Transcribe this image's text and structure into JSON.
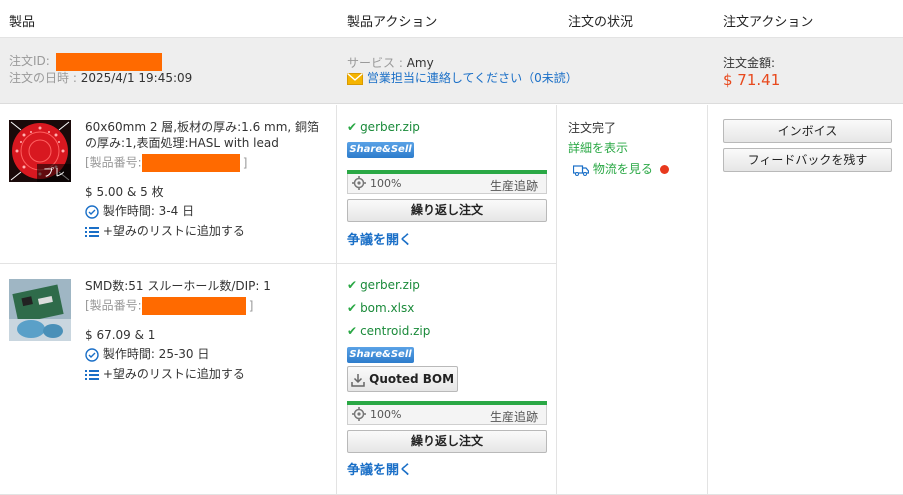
{
  "header": {
    "col_product": "製品",
    "col_product_action": "製品アクション",
    "col_order_status": "注文の状況",
    "col_order_action": "注文アクション"
  },
  "order": {
    "id_label": "注文ID:",
    "date_label": "注文の日時 :",
    "date_value": "2025/4/1 19:45:09",
    "service_label": "サービス :",
    "service_name": "Amy",
    "contact_text": "営業担当に連絡してください（0未読）",
    "amount_label": "注文金額:",
    "amount_value": "$ 71.41"
  },
  "items": [
    {
      "description": "60x60mm 2 層,板材の厚み:1.6 mm, 銅箔の厚み:1,表面処理:HASL with lead",
      "part_no_label": "[製品番号:",
      "part_no_close": "]",
      "price": "$ 5.00 & 5 枚",
      "lead_time": "製作時間: 3-4 日",
      "wishlist": "+望みのリストに追加する",
      "thumb_badge": "プレ",
      "files": [
        "gerber.zip"
      ],
      "share_label": "Share&Sell",
      "progress_pct": "100%",
      "progress_value": 100,
      "track_label": "生産追跡",
      "reorder_label": "繰り返し注文",
      "dispute_label": "争議を開く"
    },
    {
      "description": "SMD数:51 スルーホール数/DIP: 1",
      "part_no_label": "[製品番号:",
      "part_no_close": "]",
      "price": "$ 67.09 & 1",
      "lead_time": "製作時間: 25-30 日",
      "wishlist": "+望みのリストに追加する",
      "files": [
        "gerber.zip",
        "bom.xlsx",
        "centroid.zip"
      ],
      "share_label": "Share&Sell",
      "quoted_bom_label": "Quoted BOM",
      "progress_pct": "100%",
      "progress_value": 100,
      "track_label": "生産追跡",
      "reorder_label": "繰り返し注文",
      "dispute_label": "争議を開く"
    }
  ],
  "status": {
    "state": "注文完了",
    "detail_link": "詳細を表示",
    "logistics_link": "物流を見る"
  },
  "actions": {
    "invoice": "インボイス",
    "feedback": "フィードバックを残す"
  },
  "colors": {
    "accent_orange": "#ff6a00",
    "price_red": "#e8491d",
    "link_blue": "#1a6fc7",
    "success_green": "#2aa845"
  }
}
